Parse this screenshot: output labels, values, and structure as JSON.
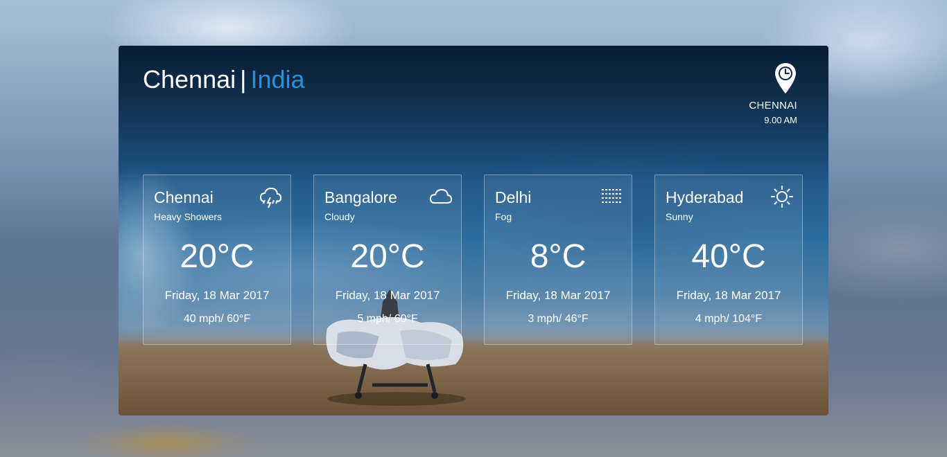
{
  "header": {
    "city": "Chennai",
    "separator": "|",
    "country": "India"
  },
  "location": {
    "icon": "location-clock-icon",
    "city": "CHENNAI",
    "time": "9.00 AM"
  },
  "forecasts": [
    {
      "city": "Chennai",
      "condition": "Heavy Showers",
      "icon": "thunderstorm-icon",
      "temperature": "20°C",
      "date": "Friday, 18 Mar 2017",
      "wind": "40 mph/ 60°F"
    },
    {
      "city": "Bangalore",
      "condition": "Cloudy",
      "icon": "cloud-icon",
      "temperature": "20°C",
      "date": "Friday, 18 Mar 2017",
      "wind": "5 mph/ 60°F"
    },
    {
      "city": "Delhi",
      "condition": "Fog",
      "icon": "fog-icon",
      "temperature": "8°C",
      "date": "Friday, 18 Mar 2017",
      "wind": "3 mph/ 46°F"
    },
    {
      "city": "Hyderabad",
      "condition": "Sunny",
      "icon": "sun-icon",
      "temperature": "40°C",
      "date": "Friday, 18 Mar 2017",
      "wind": "4 mph/ 104°F"
    }
  ],
  "colors": {
    "accent": "#2b8fd6",
    "text": "#ffffff"
  }
}
